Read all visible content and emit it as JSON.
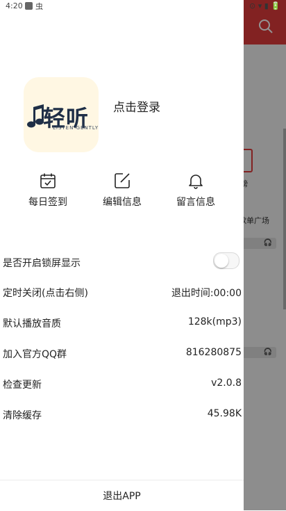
{
  "status_bar": {
    "time": "4:20",
    "bug_glyph": "虫",
    "right_icons": "⊙ ▾ ▮ 🔋"
  },
  "background_app": {
    "header_color": "#e03c3c",
    "ranking_label": "榜",
    "square_label": "歌单广场"
  },
  "drawer": {
    "logo": {
      "brand_text": "轻听",
      "tagline": "LISTEN GENTLY",
      "background": "#fff7e3",
      "text_color": "#1f2f47"
    },
    "login_text": "点击登录",
    "quick_actions": [
      {
        "label": "每日签到",
        "icon": "calendar-check-icon"
      },
      {
        "label": "编辑信息",
        "icon": "edit-icon"
      },
      {
        "label": "留言信息",
        "icon": "bell-icon"
      }
    ],
    "settings": {
      "lock_screen": {
        "label": "是否开启锁屏显示",
        "enabled": false
      },
      "timer": {
        "label": "定时关闭(点击右侧)",
        "value": "退出时间:00:00"
      },
      "quality": {
        "label": "默认播放音质",
        "value": "128k(mp3)"
      },
      "qq_group": {
        "label": "加入官方QQ群",
        "value": "816280875"
      },
      "update": {
        "label": "检查更新",
        "value": "v2.0.8"
      },
      "cache": {
        "label": "清除缓存",
        "value": "45.98K"
      }
    },
    "exit_label": "退出APP"
  }
}
